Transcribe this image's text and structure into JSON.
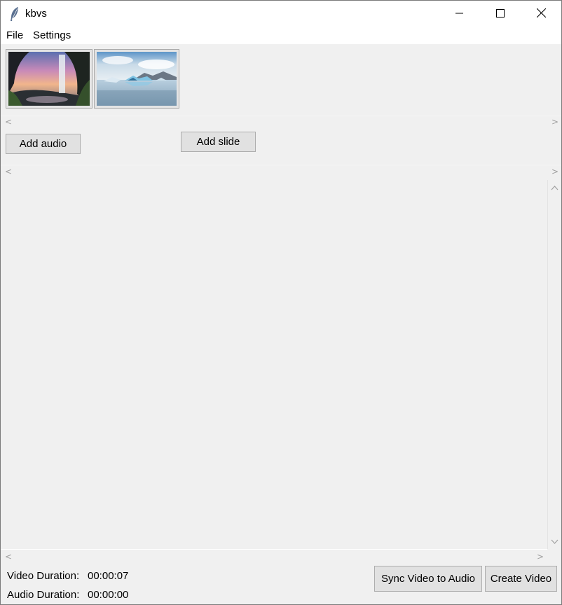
{
  "window": {
    "title": "kbvs",
    "icon": "feather-icon",
    "controls": {
      "minimize": "minimize-icon",
      "maximize": "maximize-icon",
      "close": "close-icon"
    }
  },
  "menu": {
    "items": [
      {
        "label": "File"
      },
      {
        "label": "Settings"
      }
    ]
  },
  "slides": {
    "thumbnails": [
      {
        "name": "waterfall-cave-sunset"
      },
      {
        "name": "glacier-lagoon-icebergs"
      }
    ],
    "add_label": "Add slide"
  },
  "audio": {
    "add_label": "Add audio"
  },
  "status": {
    "video_label": "Video Duration:",
    "video_value": "00:00:07",
    "audio_label": "Audio Duration:",
    "audio_value": "00:00:00"
  },
  "actions": {
    "sync_label": "Sync Video to Audio",
    "create_label": "Create Video"
  },
  "colors": {
    "window_bg": "#f0f0f0",
    "button_bg": "#e1e1e1",
    "button_border": "#adadad",
    "scroll_arrow": "#a0a0a0"
  }
}
